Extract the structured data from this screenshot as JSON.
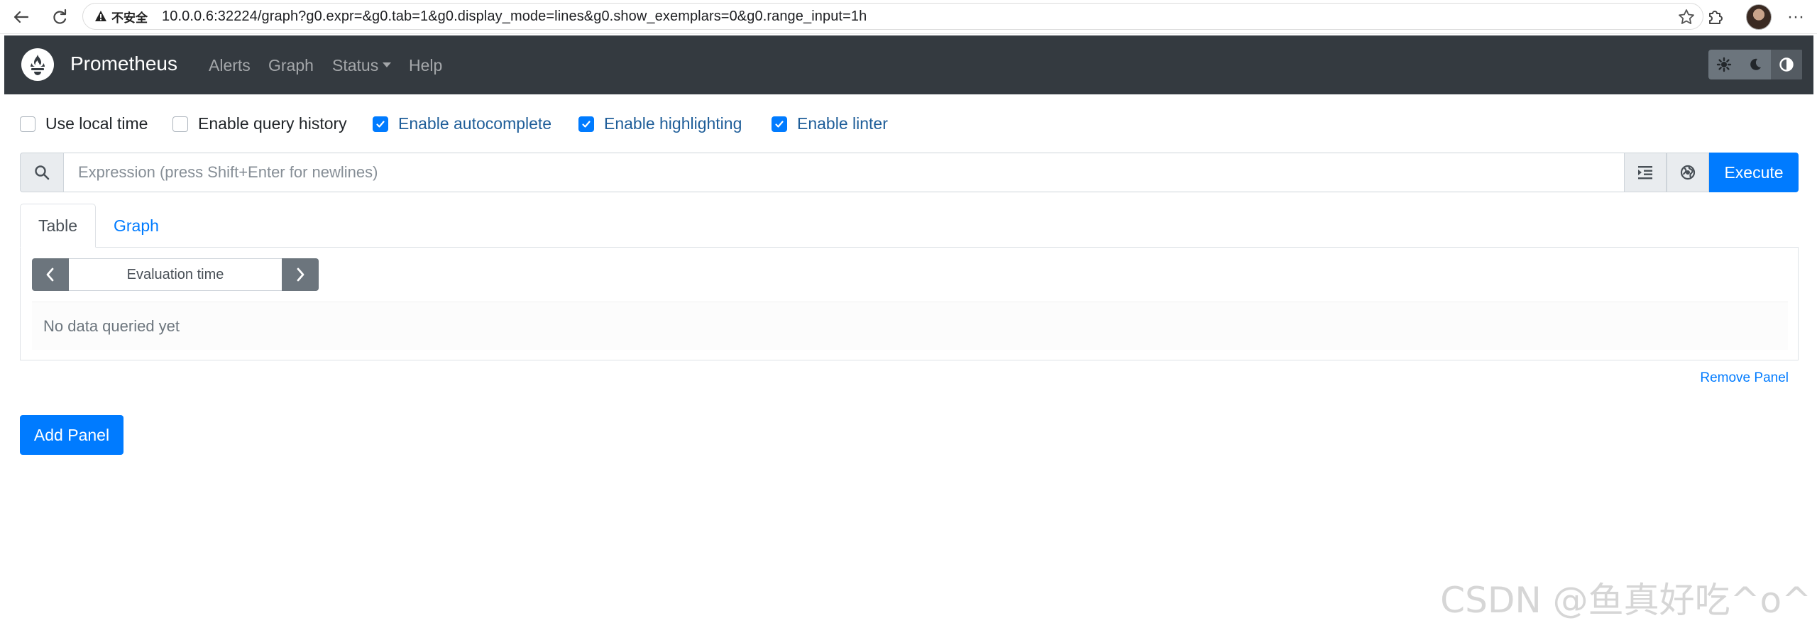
{
  "browser": {
    "security_label": "不安全",
    "url": "10.0.0.6:32224/graph?g0.expr=&g0.tab=1&g0.display_mode=lines&g0.show_exemplars=0&g0.range_input=1h",
    "more_glyph": "···"
  },
  "navbar": {
    "brand": "Prometheus",
    "links": {
      "alerts": "Alerts",
      "graph": "Graph",
      "status": "Status",
      "help": "Help"
    },
    "theme_buttons": [
      "light-theme-icon",
      "dark-theme-icon",
      "browser-theme-icon"
    ]
  },
  "options": {
    "use_local_time": {
      "label": "Use local time",
      "checked": false
    },
    "enable_query_history": {
      "label": "Enable query history",
      "checked": false
    },
    "enable_autocomplete": {
      "label": "Enable autocomplete",
      "checked": true
    },
    "enable_highlighting": {
      "label": "Enable highlighting",
      "checked": true
    },
    "enable_linter": {
      "label": "Enable linter",
      "checked": true
    }
  },
  "expression": {
    "placeholder": "Expression (press Shift+Enter for newlines)",
    "value": "",
    "execute_label": "Execute"
  },
  "panel": {
    "tabs": {
      "table": "Table",
      "graph": "Graph"
    },
    "active_tab": "Table",
    "eval_time_placeholder": "Evaluation time",
    "no_data_text": "No data queried yet",
    "remove_label": "Remove Panel"
  },
  "add_panel_label": "Add Panel",
  "watermark": "CSDN @鱼真好吃^o^",
  "colors": {
    "navbar_bg": "#343a40",
    "primary": "#007bff",
    "secondary": "#6c757d"
  }
}
